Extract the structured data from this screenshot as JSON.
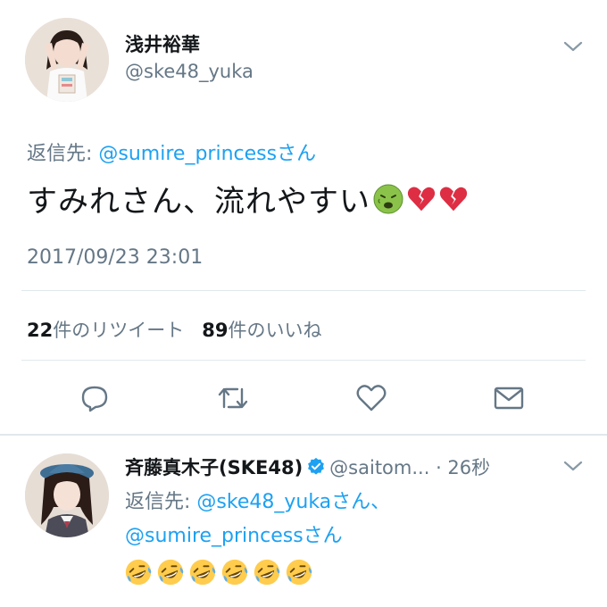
{
  "tweet": {
    "display_name": "浅井裕華",
    "handle": "@ske48_yuka",
    "reply_prefix": "返信先: ",
    "reply_mention": "@sumire_princess",
    "reply_suffix": "さん",
    "text": "すみれさん、流れやすい",
    "emojis": [
      "nauseated-face-emoji",
      "broken-heart-emoji",
      "broken-heart-emoji"
    ],
    "timestamp": "2017/09/23 23:01",
    "retweet_count": "22",
    "retweet_label": "件のリツイート",
    "like_count": "89",
    "like_label": "件のいいね"
  },
  "actions": [
    {
      "name": "reply-icon"
    },
    {
      "name": "retweet-icon"
    },
    {
      "name": "like-icon"
    },
    {
      "name": "dm-icon"
    }
  ],
  "reply": {
    "display_name": "斉藤真木子(SKE48)",
    "handle": "@saitom...",
    "separator": " · ",
    "time": "26秒",
    "reply_prefix": "返信先: ",
    "mention1": "@ske48_yukaさん、",
    "mention2": "@sumire_princessさん",
    "emoji_name": "rolling-on-floor-laughing-emoji",
    "emoji_count": 6
  },
  "colors": {
    "link": "#1da1f2",
    "secondary": "#657786",
    "verified": "#1da1f2"
  }
}
